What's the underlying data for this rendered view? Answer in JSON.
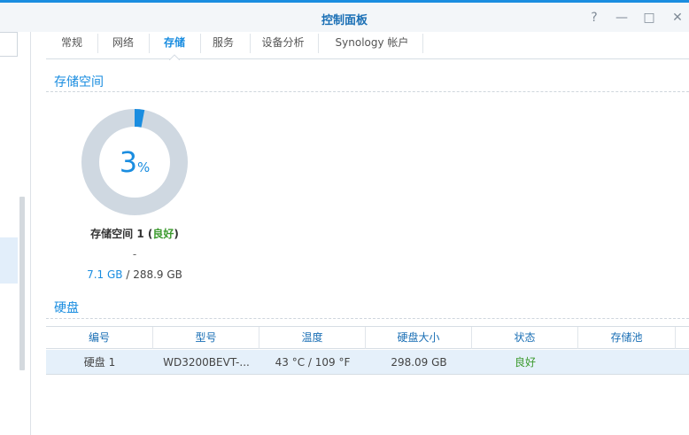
{
  "window": {
    "title": "控制面板",
    "controls": [
      "?",
      "—",
      "□",
      "✕"
    ]
  },
  "tabs": [
    {
      "label": "常规",
      "active": false
    },
    {
      "label": "网络",
      "active": false
    },
    {
      "label": "存储",
      "active": true
    },
    {
      "label": "服务",
      "active": false
    },
    {
      "label": "设备分析",
      "active": false
    },
    {
      "label": "Synology 帐户",
      "active": false
    }
  ],
  "storage": {
    "section_title": "存储空间",
    "percent": 3,
    "percent_sign": "%",
    "volume_name": "存储空间 1",
    "volume_status": "良好",
    "dash": "-",
    "used": "7.1 GB",
    "separator": " / ",
    "total": "288.9 GB"
  },
  "disks": {
    "section_title": "硬盘",
    "columns": [
      "编号",
      "型号",
      "温度",
      "硬盘大小",
      "状态",
      "存储池"
    ],
    "rows": [
      {
        "id": "硬盘 1",
        "model": "WD3200BEVT-...",
        "temp": "43 °C / 109 °F",
        "size": "298.09 GB",
        "status": "良好",
        "pool": ""
      }
    ]
  },
  "colors": {
    "accent": "#1a8de0",
    "good": "#3c9a2e",
    "donut_track": "#cfd8e1"
  }
}
